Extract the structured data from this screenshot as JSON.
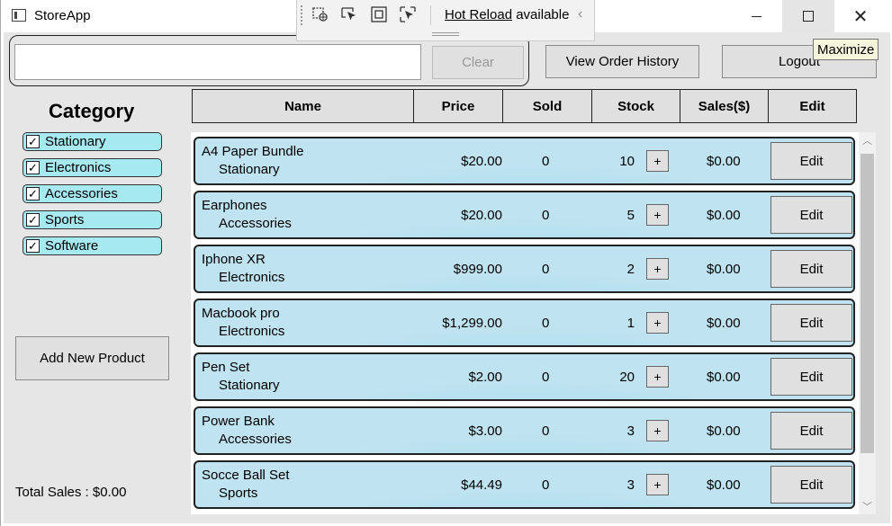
{
  "window": {
    "title": "StoreApp",
    "tooltip": "Maximize",
    "minimize_icon": "minimize-icon",
    "maximize_icon": "maximize-icon",
    "close_icon": "close-icon"
  },
  "hot_reload": {
    "link": "Hot Reload",
    "suffix": " available",
    "tools": [
      "select-element-icon",
      "select-pointer-icon",
      "layout-adorner-icon",
      "track-focus-icon"
    ]
  },
  "search": {
    "value": "",
    "placeholder": ""
  },
  "toolbar": {
    "clear_label": "Clear",
    "order_history_label": "View Order History",
    "logout_label": "Logout"
  },
  "category": {
    "title": "Category",
    "items": [
      {
        "label": "Stationary",
        "checked": true
      },
      {
        "label": "Electronics",
        "checked": true
      },
      {
        "label": "Accessories",
        "checked": true
      },
      {
        "label": "Sports",
        "checked": true
      },
      {
        "label": "Software",
        "checked": true
      }
    ],
    "check_glyph": "✓"
  },
  "add_product_label": "Add New Product",
  "total_sales": "Total Sales : $0.00",
  "columns": {
    "name": "Name",
    "price": "Price",
    "sold": "Sold",
    "stock": "Stock",
    "sales": "Sales($)",
    "edit": "Edit"
  },
  "products": [
    {
      "name": "A4 Paper Bundle",
      "category": "Stationary",
      "price": "$20.00",
      "sold": "0",
      "stock": "10",
      "sales": "$0.00",
      "plus": "+",
      "edit": "Edit"
    },
    {
      "name": "Earphones",
      "category": "Accessories",
      "price": "$20.00",
      "sold": "0",
      "stock": "5",
      "sales": "$0.00",
      "plus": "+",
      "edit": "Edit"
    },
    {
      "name": "Iphone XR",
      "category": "Electronics",
      "price": "$999.00",
      "sold": "0",
      "stock": "2",
      "sales": "$0.00",
      "plus": "+",
      "edit": "Edit"
    },
    {
      "name": "Macbook pro",
      "category": "Electronics",
      "price": "$1,299.00",
      "sold": "0",
      "stock": "1",
      "sales": "$0.00",
      "plus": "+",
      "edit": "Edit"
    },
    {
      "name": "Pen Set",
      "category": "Stationary",
      "price": "$2.00",
      "sold": "0",
      "stock": "20",
      "sales": "$0.00",
      "plus": "+",
      "edit": "Edit"
    },
    {
      "name": "Power Bank",
      "category": "Accessories",
      "price": "$3.00",
      "sold": "0",
      "stock": "3",
      "sales": "$0.00",
      "plus": "+",
      "edit": "Edit"
    },
    {
      "name": "Socce Ball Set",
      "category": "Sports",
      "price": "$44.49",
      "sold": "0",
      "stock": "3",
      "sales": "$0.00",
      "plus": "+",
      "edit": "Edit"
    }
  ],
  "colors": {
    "category_chip": "#a7e9f1",
    "row_gradient_center": "#3fbdf2",
    "row_gradient_edge": "#bfe3f0"
  }
}
